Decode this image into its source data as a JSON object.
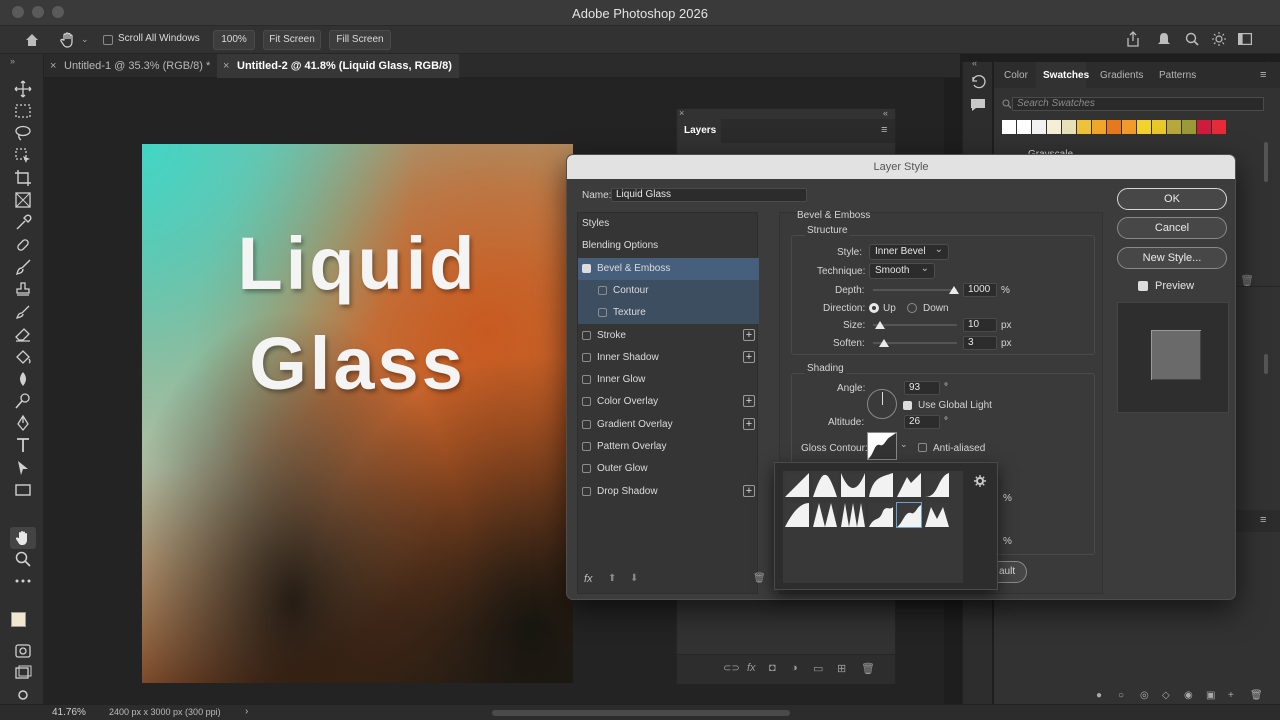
{
  "app": {
    "title": "Adobe Photoshop 2026"
  },
  "options_bar": {
    "scroll_all_windows": "Scroll All Windows",
    "zoom_100": "100%",
    "fit_screen": "Fit Screen",
    "fill_screen": "Fill Screen"
  },
  "tabs": [
    {
      "label": "Untitled-1 @ 35.3% (RGB/8) *",
      "active": false
    },
    {
      "label": "Untitled-2 @ 41.8% (Liquid Glass, RGB/8) *",
      "active": true
    }
  ],
  "canvas": {
    "text": "Liquid\nGlass"
  },
  "status": {
    "zoom": "41.76%",
    "doc_info": "2400 px x 3000 px (300 ppi)"
  },
  "right_panel": {
    "tabs": [
      "Color",
      "Swatches",
      "Gradients",
      "Patterns"
    ],
    "active_tab": "Swatches",
    "search_placeholder": "Search Swatches",
    "group_label": "Grayscale",
    "swatch_colors": [
      "#ffffff",
      "#ffffff",
      "#f2f2f2",
      "#f4efd6",
      "#e8e0b8",
      "#f0c23a",
      "#f0a62a",
      "#e8781e",
      "#f29a2c",
      "#f2d22e",
      "#e8c82a",
      "#b6a83a",
      "#9a9a38",
      "#d01c3c",
      "#e62a3a"
    ]
  },
  "layers_panel": {
    "title": "Layers"
  },
  "dialog": {
    "title": "Layer Style",
    "name_label": "Name:",
    "name_value": "Liquid Glass",
    "style_list": [
      {
        "label": "Styles",
        "checkbox": false,
        "plus": false,
        "state": "normal"
      },
      {
        "label": "Blending Options",
        "checkbox": false,
        "plus": false,
        "state": "normal"
      },
      {
        "label": "Bevel & Emboss",
        "checkbox": true,
        "checked": true,
        "plus": false,
        "state": "selected"
      },
      {
        "label": "Contour",
        "checkbox": true,
        "checked": false,
        "plus": false,
        "state": "sub"
      },
      {
        "label": "Texture",
        "checkbox": true,
        "checked": false,
        "plus": false,
        "state": "sub"
      },
      {
        "label": "Stroke",
        "checkbox": true,
        "checked": false,
        "plus": true,
        "state": "normal"
      },
      {
        "label": "Inner Shadow",
        "checkbox": true,
        "checked": false,
        "plus": true,
        "state": "normal"
      },
      {
        "label": "Inner Glow",
        "checkbox": true,
        "checked": false,
        "plus": false,
        "state": "normal"
      },
      {
        "label": "Color Overlay",
        "checkbox": true,
        "checked": false,
        "plus": true,
        "state": "normal"
      },
      {
        "label": "Gradient Overlay",
        "checkbox": true,
        "checked": false,
        "plus": true,
        "state": "normal"
      },
      {
        "label": "Pattern Overlay",
        "checkbox": true,
        "checked": false,
        "plus": false,
        "state": "normal"
      },
      {
        "label": "Outer Glow",
        "checkbox": true,
        "checked": false,
        "plus": false,
        "state": "normal"
      },
      {
        "label": "Drop Shadow",
        "checkbox": true,
        "checked": false,
        "plus": true,
        "state": "normal"
      }
    ],
    "fx_label": "fx",
    "section_title": "Bevel & Emboss",
    "structure": {
      "title": "Structure",
      "style_label": "Style:",
      "style_value": "Inner Bevel",
      "technique_label": "Technique:",
      "technique_value": "Smooth",
      "depth_label": "Depth:",
      "depth_value": "1000",
      "depth_unit": "%",
      "direction_label": "Direction:",
      "dir_up": "Up",
      "dir_down": "Down",
      "size_label": "Size:",
      "size_value": "10",
      "size_unit": "px",
      "soften_label": "Soften:",
      "soften_value": "3",
      "soften_unit": "px"
    },
    "shading": {
      "title": "Shading",
      "angle_label": "Angle:",
      "angle_value": "93",
      "angle_unit": "°",
      "use_global_light": "Use Global Light",
      "altitude_label": "Altitude:",
      "altitude_value": "26",
      "altitude_unit": "°",
      "gloss_label": "Gloss Contour:",
      "anti_aliased": "Anti-aliased"
    },
    "hidden_partial": {
      "pct1": "%",
      "pct2": "%",
      "default_fragment": "ault"
    },
    "buttons": {
      "ok": "OK",
      "cancel": "Cancel",
      "new_style": "New Style..."
    },
    "preview_label": "Preview"
  }
}
